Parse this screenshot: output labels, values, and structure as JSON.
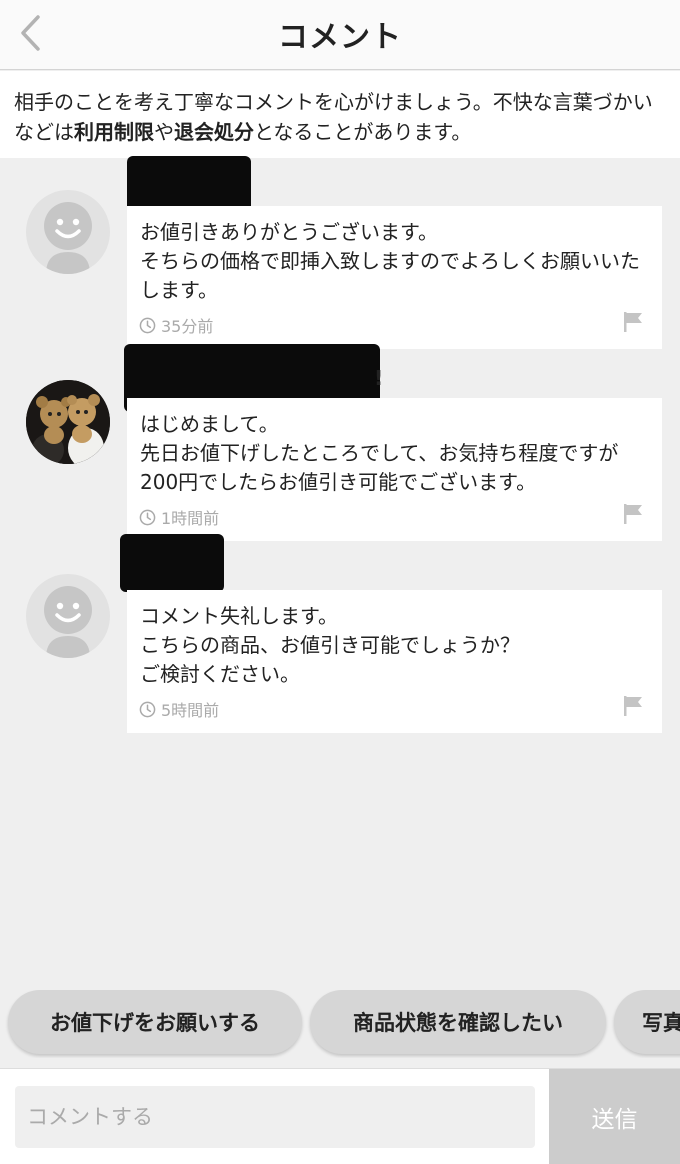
{
  "header": {
    "title": "コメント",
    "back_icon": "chevron-left-icon"
  },
  "notice": {
    "text_1": "相手のことを考え丁寧なコメントを心がけましょう。不快な言葉づかいなどは",
    "bold_1": "利用制限",
    "text_2": "や",
    "bold_2": "退会処分",
    "text_3": "となることがあります。"
  },
  "comments": [
    {
      "avatar": "default-face-avatar",
      "text": "お値引きありがとうございます。\nそちらの価格で即挿入致しますのでよろしくお願いいたします。",
      "time": "35分前"
    },
    {
      "avatar": "photo-avatar",
      "name_suffix": "!",
      "text": "はじめまして。\n先日お値下げしたところでして、お気持ち程度ですが200円でしたらお値引き可能でございます。",
      "time": "1時間前"
    },
    {
      "avatar": "default-face-avatar",
      "text": "コメント失礼します。\nこちらの商品、お値引き可能でしょうか？\nご検討ください。",
      "time": "5時間前"
    }
  ],
  "chips": [
    "お値下げをお願いする",
    "商品状態を確認したい",
    "写真"
  ],
  "input": {
    "placeholder": "コメントする",
    "value": ""
  },
  "send": {
    "label": "送信"
  },
  "colors": {
    "background": "#efefef",
    "send_button": "#cccccc",
    "chip": "#d6d6d6"
  }
}
